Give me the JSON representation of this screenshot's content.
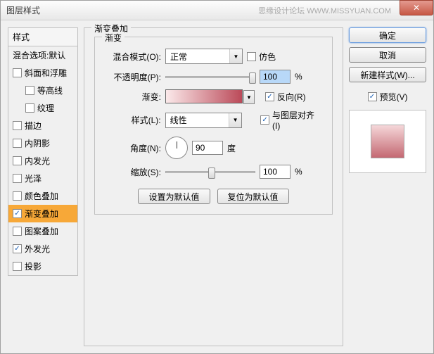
{
  "window": {
    "title": "图层样式",
    "watermark": "思缘设计论坛  WWW.MISSYUAN.COM"
  },
  "styles": {
    "header_title": "样式",
    "blend_options": "混合选项:默认",
    "items": [
      {
        "label": "斜面和浮雕",
        "checked": false,
        "indent": false
      },
      {
        "label": "等高线",
        "checked": false,
        "indent": true
      },
      {
        "label": "纹理",
        "checked": false,
        "indent": true
      },
      {
        "label": "描边",
        "checked": false,
        "indent": false
      },
      {
        "label": "内阴影",
        "checked": false,
        "indent": false
      },
      {
        "label": "内发光",
        "checked": false,
        "indent": false
      },
      {
        "label": "光泽",
        "checked": false,
        "indent": false
      },
      {
        "label": "颜色叠加",
        "checked": false,
        "indent": false
      },
      {
        "label": "渐变叠加",
        "checked": true,
        "indent": false,
        "selected": true
      },
      {
        "label": "图案叠加",
        "checked": false,
        "indent": false
      },
      {
        "label": "外发光",
        "checked": true,
        "indent": false
      },
      {
        "label": "投影",
        "checked": false,
        "indent": false
      }
    ]
  },
  "gradient_overlay": {
    "group_title": "渐变叠加",
    "subgroup_title": "渐变",
    "blend_mode": {
      "label": "混合模式(O):",
      "value": "正常"
    },
    "dither": {
      "label": "仿色",
      "checked": false
    },
    "opacity": {
      "label": "不透明度(P):",
      "value": "100",
      "unit": "%"
    },
    "gradient": {
      "label": "渐变:"
    },
    "reverse": {
      "label": "反向(R)",
      "checked": true
    },
    "style": {
      "label": "样式(L):",
      "value": "线性"
    },
    "align": {
      "label": "与图层对齐(I)",
      "checked": true
    },
    "angle": {
      "label": "角度(N):",
      "value": "90",
      "unit": "度"
    },
    "scale": {
      "label": "缩放(S):",
      "value": "100",
      "unit": "%"
    },
    "btn_default": "设置为默认值",
    "btn_reset": "复位为默认值"
  },
  "buttons": {
    "ok": "确定",
    "cancel": "取消",
    "new_style": "新建样式(W)...",
    "preview": {
      "label": "预览(V)",
      "checked": true
    }
  }
}
